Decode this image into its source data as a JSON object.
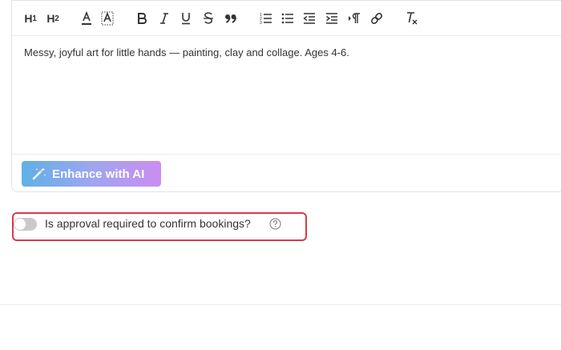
{
  "editor": {
    "toolbar": {
      "h1_label": "H",
      "h1_sub": "1",
      "h2_label": "H",
      "h2_sub": "2",
      "buttons": [
        "heading-1-button",
        "heading-2-button",
        "font-color-button",
        "highlight-button",
        "bold-button",
        "italic-button",
        "underline-button",
        "strikethrough-button",
        "blockquote-button",
        "ordered-list-button",
        "bullet-list-button",
        "outdent-button",
        "indent-button",
        "paragraph-direction-button",
        "link-button",
        "clear-formatting-button"
      ]
    },
    "content": "Messy, joyful art for little hands — painting, clay and collage. Ages 4-6.",
    "enhance_button_label": "Enhance with AI"
  },
  "approval": {
    "label": "Is approval required to confirm bookings?",
    "toggle_on": false,
    "help_icon": "question-circle-icon"
  },
  "colors": {
    "ai_gradient_start": "#5fb0e6",
    "ai_gradient_end": "#cb8df1",
    "highlight_border": "#d83a4a",
    "toggle_off": "#c9c9c9"
  }
}
